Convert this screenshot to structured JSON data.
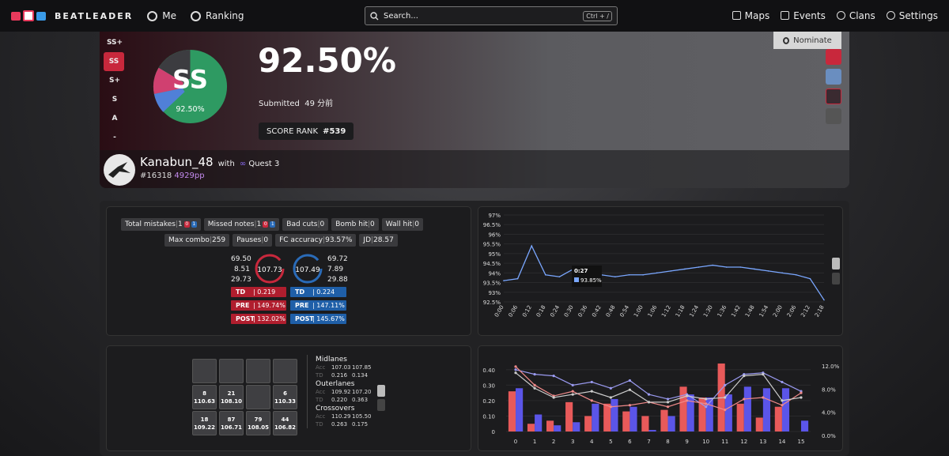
{
  "nav": {
    "brand": "BEATLEADER",
    "me": "Me",
    "ranking": "Ranking",
    "search_placeholder": "Search...",
    "search_kbd": "Ctrl + /",
    "maps": "Maps",
    "events": "Events",
    "clans": "Clans",
    "settings": "Settings"
  },
  "score": {
    "ranks": [
      "SS+",
      "SS",
      "S+",
      "S",
      "A",
      "-"
    ],
    "selected_rank": "SS",
    "badge": "SS",
    "badge_pct": "92.50%",
    "accuracy": "92.50%",
    "submitted_label": "Submitted",
    "submitted_value": "49 分前",
    "score_rank_label": "SCORE RANK",
    "score_rank_value": "#539",
    "nominate": "Nominate"
  },
  "player": {
    "name": "Kanabun_48",
    "with_label": "with",
    "device": "Quest 3",
    "rank": "#16318",
    "pp": "4929pp"
  },
  "stats": {
    "tags_row1": [
      {
        "label": "Total mistakes",
        "value": "1",
        "pills": [
          "0",
          "1"
        ]
      },
      {
        "label": "Missed notes",
        "value": "1",
        "pills": [
          "0",
          "1"
        ]
      },
      {
        "label": "Bad cuts",
        "value": "0"
      },
      {
        "label": "Bomb hit",
        "value": "0"
      },
      {
        "label": "Wall hit",
        "value": "0"
      }
    ],
    "tags_row2": [
      {
        "label": "Max combo",
        "value": "259"
      },
      {
        "label": "Pauses",
        "value": "0"
      },
      {
        "label": "FC accuracy",
        "value": "93.57%"
      },
      {
        "label": "JD",
        "value": "28.57"
      }
    ],
    "left_hand": {
      "nums": [
        "69.50",
        "8.51",
        "29.73"
      ],
      "avg": "107.73",
      "td": "0.219",
      "pre": "149.74%",
      "post": "132.02%"
    },
    "right_hand": {
      "nums": [
        "69.72",
        "7.89",
        "29.88"
      ],
      "avg": "107.49",
      "td": "0.224",
      "pre": "147.11%",
      "post": "145.67%"
    },
    "td_label": "TD",
    "pre_label": "PRE",
    "post_label": "POST"
  },
  "grid": {
    "cells": [
      [
        "",
        ""
      ],
      [
        "",
        ""
      ],
      [
        "",
        ""
      ],
      [
        "",
        ""
      ],
      [
        "8",
        "110.63"
      ],
      [
        "21",
        "108.10"
      ],
      [
        "",
        ""
      ],
      [
        "6",
        "110.33"
      ],
      [
        "18",
        "109.22"
      ],
      [
        "87",
        "106.71"
      ],
      [
        "79",
        "108.05"
      ],
      [
        "44",
        "106.82"
      ]
    ]
  },
  "lanes": [
    {
      "name": "Midlanes",
      "acc": [
        "107.03",
        "107.85"
      ],
      "td": [
        "0.216",
        "0.134"
      ]
    },
    {
      "name": "Outerlanes",
      "acc": [
        "109.92",
        "107.20"
      ],
      "td": [
        "0.220",
        "0.363"
      ]
    },
    {
      "name": "Crossovers",
      "acc": [
        "110.29",
        "105.50"
      ],
      "td": [
        "0.263",
        "0.175"
      ]
    }
  ],
  "lane_acc_label": "Acc",
  "lane_td_label": "TD",
  "chart_data": [
    {
      "type": "line",
      "ylabels": [
        "97%",
        "96.5%",
        "96%",
        "95.5%",
        "95%",
        "94.5%",
        "94%",
        "93.5%",
        "93%",
        "92.5%"
      ],
      "ylim": [
        92.5,
        97
      ],
      "x": [
        "0:00",
        "0:06",
        "0:12",
        "0:18",
        "0:24",
        "0:30",
        "0:36",
        "0:42",
        "0:48",
        "0:54",
        "1:00",
        "1:06",
        "1:12",
        "1:18",
        "1:24",
        "1:30",
        "1:36",
        "1:42",
        "1:48",
        "1:54",
        "2:00",
        "2:06",
        "2:12",
        "2:18"
      ],
      "values": [
        93.6,
        93.7,
        95.4,
        93.9,
        93.8,
        94.2,
        93.9,
        93.9,
        93.8,
        93.9,
        93.9,
        94.0,
        94.1,
        94.2,
        94.3,
        94.4,
        94.3,
        94.3,
        94.2,
        94.1,
        94.0,
        93.9,
        93.7,
        92.6
      ],
      "tooltip": {
        "time": "0:27",
        "value": "93.85%"
      },
      "color": "#7aa7ff"
    },
    {
      "type": "bar",
      "categories": [
        "0",
        "1",
        "2",
        "3",
        "4",
        "5",
        "6",
        "7",
        "8",
        "9",
        "10",
        "11",
        "12",
        "13",
        "14",
        "15"
      ],
      "ylabels": [
        "0.40",
        "0.30",
        "0.20",
        "0.10",
        "0"
      ],
      "y2labels": [
        "12.0%",
        "8.0%",
        "4.0%",
        "0.0%"
      ],
      "ylim": [
        0,
        0.45
      ],
      "series": [
        {
          "color": "#e85a5a",
          "values": [
            0.26,
            0.05,
            0.07,
            0.19,
            0.1,
            0.18,
            0.13,
            0.1,
            0.14,
            0.29,
            0.22,
            0.44,
            0.18,
            0.09,
            0.16,
            0.0
          ]
        },
        {
          "color": "#5b55e8",
          "values": [
            0.28,
            0.11,
            0.04,
            0.06,
            0.18,
            0.21,
            0.16,
            0.01,
            0.1,
            0.24,
            0.22,
            0.24,
            0.29,
            0.28,
            0.28,
            0.07
          ]
        }
      ],
      "lines": [
        {
          "color": "#9a9af0",
          "values": [
            0.4,
            0.37,
            0.36,
            0.3,
            0.32,
            0.28,
            0.33,
            0.24,
            0.21,
            0.24,
            0.16,
            0.3,
            0.37,
            0.38,
            0.32,
            0.26
          ]
        },
        {
          "color": "#f08a8a",
          "values": [
            0.42,
            0.3,
            0.23,
            0.26,
            0.2,
            0.16,
            0.17,
            0.19,
            0.16,
            0.2,
            0.18,
            0.14,
            0.21,
            0.22,
            0.17,
            0.25
          ]
        },
        {
          "color": "#cccccc",
          "values": [
            0.38,
            0.28,
            0.22,
            0.24,
            0.26,
            0.22,
            0.27,
            0.19,
            0.19,
            0.23,
            0.21,
            0.22,
            0.36,
            0.37,
            0.2,
            0.22
          ]
        }
      ]
    }
  ]
}
